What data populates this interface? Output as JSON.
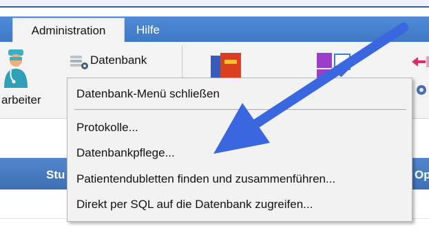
{
  "menubar": {
    "tabs": [
      {
        "label": "Administration",
        "active": true
      },
      {
        "label": "Hilfe",
        "active": false
      }
    ]
  },
  "ribbon": {
    "mitarbeiter_label_partial": "arbeiter",
    "datenbank_label": "Datenbank"
  },
  "dropdown": {
    "items": [
      {
        "label": "Datenbank-Menü schließen"
      },
      {
        "label": "Protokolle..."
      },
      {
        "label": "Datenbankpflege..."
      },
      {
        "label": "Patientendubletten finden und zusammenführen..."
      },
      {
        "label": "Direkt per SQL auf die Datenbank zugreifen..."
      }
    ]
  },
  "grid": {
    "header_left_partial": "Stu",
    "header_right_partial": "Op"
  },
  "colors": {
    "menubar": "#4a84d0",
    "header": "#4a7ec4",
    "annotation_arrow": "#3a66e0",
    "menu_bg": "#f2f2f2"
  }
}
